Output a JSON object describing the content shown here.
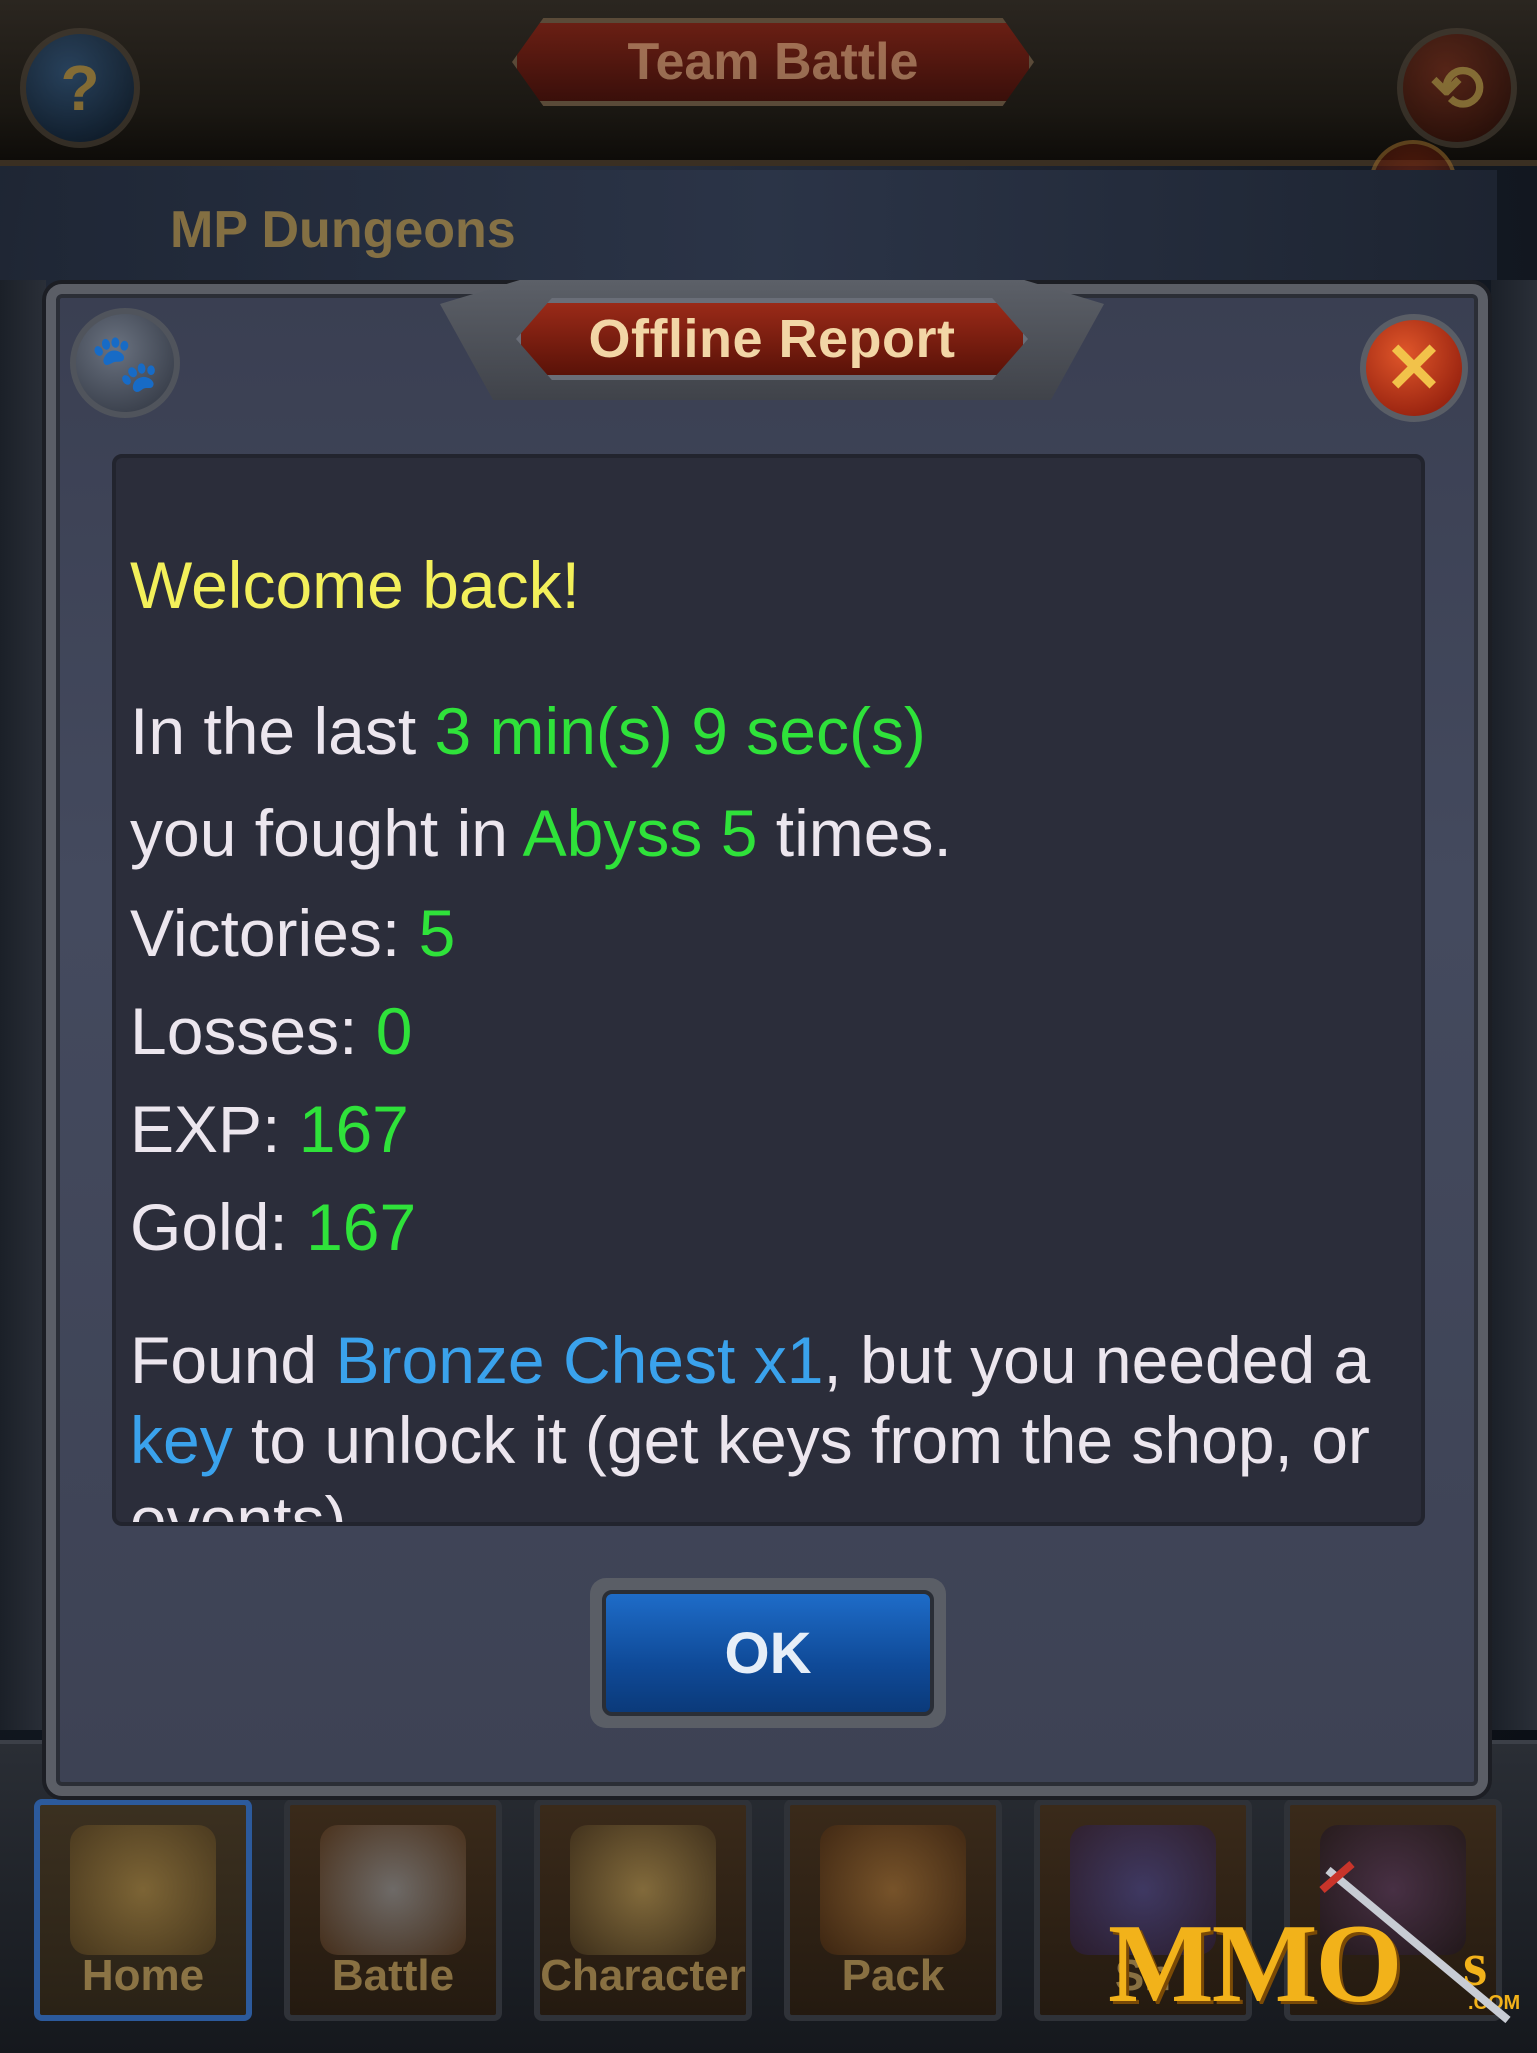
{
  "background": {
    "title": "Team Battle",
    "subtitle": "MP Dungeons",
    "help_icon": "?",
    "back_icon": "⟲"
  },
  "dialog": {
    "title": "Offline Report",
    "paw_icon": "🐾",
    "close_icon": "✕",
    "report": {
      "welcome": "Welcome back!",
      "line1_prefix": "In the last ",
      "line1_duration": "3 min(s) 9 sec(s)",
      "line2_prefix": "you fought in ",
      "line2_location": "Abyss 5",
      "line2_suffix": " times.",
      "victories_label": "Victories: ",
      "victories_value": "5",
      "losses_label": "Losses: ",
      "losses_value": "0",
      "exp_label": "EXP: ",
      "exp_value": "167",
      "gold_label": "Gold: ",
      "gold_value": "167",
      "found_prefix": "Found ",
      "found_item": "Bronze Chest x1",
      "found_middle": ", but you needed a",
      "key_word": "key",
      "found_suffix": " to unlock it (get keys from the shop, or events)."
    },
    "ok_label": "OK"
  },
  "bottom_nav": {
    "items": [
      {
        "label": "Home",
        "active": true
      },
      {
        "label": "Battle",
        "active": false
      },
      {
        "label": "Character",
        "active": false
      },
      {
        "label": "Pack",
        "active": false
      },
      {
        "label": "Sh",
        "active": false
      },
      {
        "label": "",
        "active": false
      }
    ]
  },
  "watermark": {
    "text": "MMO",
    "s": "s",
    "com": ".COM"
  },
  "colors": {
    "highlight_green": "#2fe23a",
    "highlight_blue": "#3aa2ec",
    "welcome_yellow": "#f3f05a",
    "ok_blue": "#1e6cc8",
    "close_orange": "#e0562a"
  }
}
